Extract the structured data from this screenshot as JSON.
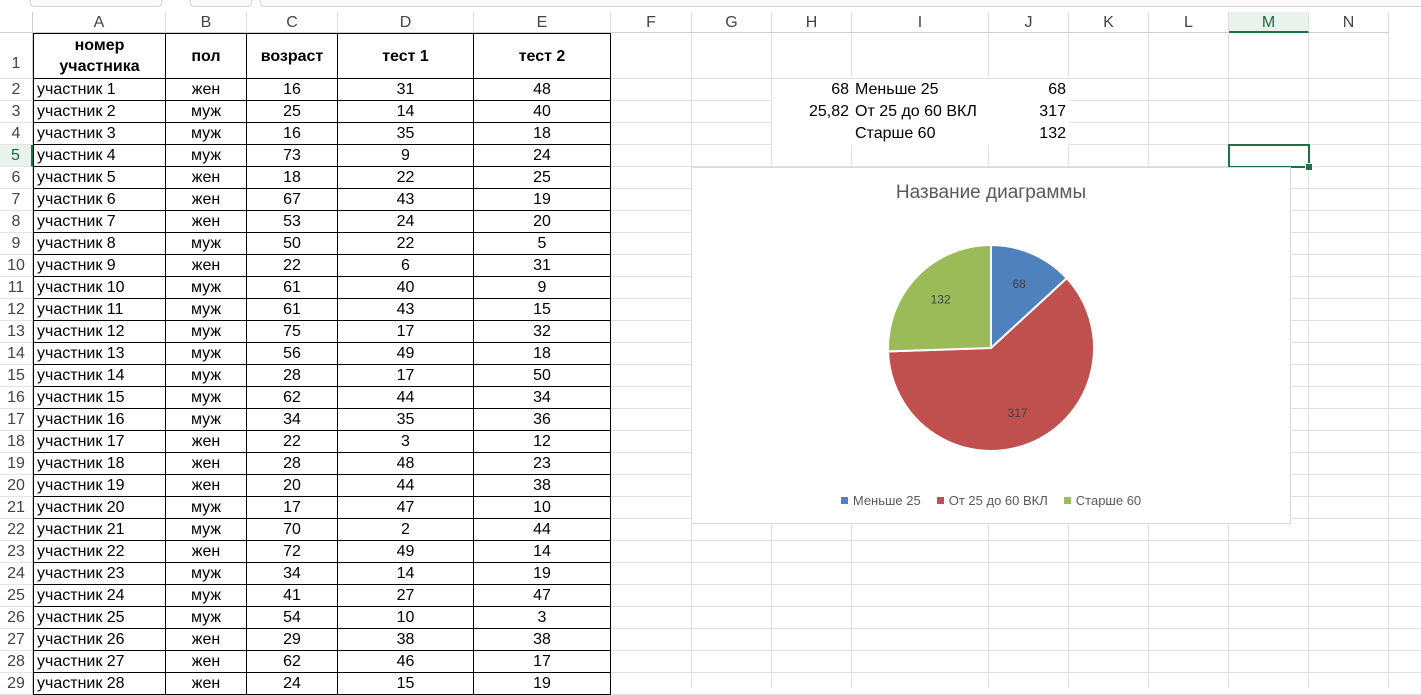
{
  "columns": [
    "A",
    "B",
    "C",
    "D",
    "E",
    "F",
    "G",
    "H",
    "I",
    "J",
    "K",
    "L",
    "M",
    "N"
  ],
  "selected_column": "M",
  "selected_row": 5,
  "table": {
    "headers": [
      "номер участника",
      "пол",
      "возраст",
      "тест 1",
      "тест 2"
    ],
    "rows": [
      [
        "участник 1",
        "жен",
        "16",
        "31",
        "48"
      ],
      [
        "участник 2",
        "муж",
        "25",
        "14",
        "40"
      ],
      [
        "участник 3",
        "муж",
        "16",
        "35",
        "18"
      ],
      [
        "участник 4",
        "муж",
        "73",
        "9",
        "24"
      ],
      [
        "участник 5",
        "жен",
        "18",
        "22",
        "25"
      ],
      [
        "участник 6",
        "жен",
        "67",
        "43",
        "19"
      ],
      [
        "участник 7",
        "жен",
        "53",
        "24",
        "20"
      ],
      [
        "участник 8",
        "муж",
        "50",
        "22",
        "5"
      ],
      [
        "участник 9",
        "жен",
        "22",
        "6",
        "31"
      ],
      [
        "участник 10",
        "муж",
        "61",
        "40",
        "9"
      ],
      [
        "участник 11",
        "муж",
        "61",
        "43",
        "15"
      ],
      [
        "участник 12",
        "муж",
        "75",
        "17",
        "32"
      ],
      [
        "участник 13",
        "муж",
        "56",
        "49",
        "18"
      ],
      [
        "участник 14",
        "муж",
        "28",
        "17",
        "50"
      ],
      [
        "участник 15",
        "муж",
        "62",
        "44",
        "34"
      ],
      [
        "участник 16",
        "муж",
        "34",
        "35",
        "36"
      ],
      [
        "участник 17",
        "жен",
        "22",
        "3",
        "12"
      ],
      [
        "участник 18",
        "жен",
        "28",
        "48",
        "23"
      ],
      [
        "участник 19",
        "жен",
        "20",
        "44",
        "38"
      ],
      [
        "участник 20",
        "муж",
        "17",
        "47",
        "10"
      ],
      [
        "участник 21",
        "муж",
        "70",
        "2",
        "44"
      ],
      [
        "участник 22",
        "жен",
        "72",
        "49",
        "14"
      ],
      [
        "участник 23",
        "муж",
        "34",
        "14",
        "19"
      ],
      [
        "участник 24",
        "муж",
        "41",
        "27",
        "47"
      ],
      [
        "участник 25",
        "муж",
        "54",
        "10",
        "3"
      ],
      [
        "участник 26",
        "жен",
        "29",
        "38",
        "38"
      ],
      [
        "участник 27",
        "жен",
        "62",
        "46",
        "17"
      ],
      [
        "участник 28",
        "жен",
        "24",
        "15",
        "19"
      ]
    ]
  },
  "summary": {
    "h_values": [
      "68",
      "25,82",
      ""
    ],
    "labels": [
      "Меньше 25",
      "От 25 до 60 ВКЛ",
      "Старше 60"
    ],
    "values": [
      "68",
      "317",
      "132"
    ]
  },
  "chart_data": {
    "type": "pie",
    "title": "Название диаграммы",
    "categories": [
      "Меньше 25",
      "От 25 до 60 ВКЛ",
      "Старше 60"
    ],
    "values": [
      68,
      317,
      132
    ],
    "colors": [
      "#4f81bd",
      "#c0504d",
      "#9bbb59"
    ],
    "data_labels": [
      "68",
      "317",
      "132"
    ],
    "legend_position": "bottom"
  }
}
